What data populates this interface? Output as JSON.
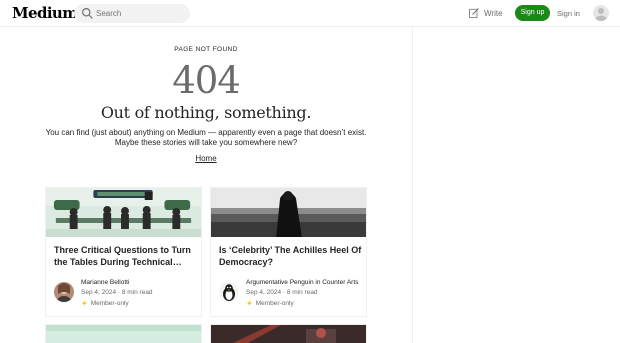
{
  "header": {
    "logo": "Medium",
    "search_placeholder": "Search",
    "write_label": "Write",
    "signup_label": "Sign up",
    "signin_label": "Sign in"
  },
  "error": {
    "eyebrow": "PAGE NOT FOUND",
    "code": "404",
    "headline": "Out of nothing, something.",
    "line1": "You can find (just about) anything on Medium — apparently even a page that doesn’t exist.",
    "line2": "Maybe these stories will take you somewhere new?",
    "home_link": "Home"
  },
  "stories": [
    {
      "title": "Three Critical Questions to Turn the Tables During Technical…",
      "author": "Marianne Bellotti",
      "date": "Sep 4, 2024 · 8 min read",
      "badge": "Member-only"
    },
    {
      "title": "Is ‘Celebrity’ The Achilles Heel Of Democracy?",
      "author": "Argumentative Penguin in Counter Arts",
      "date": "Sep 4, 2024 · 8 min read",
      "badge": "Member-only"
    }
  ],
  "colors": {
    "brand_green": "#1a8917",
    "member_star": "#ffc017",
    "muted_text": "#6b6b6b"
  }
}
